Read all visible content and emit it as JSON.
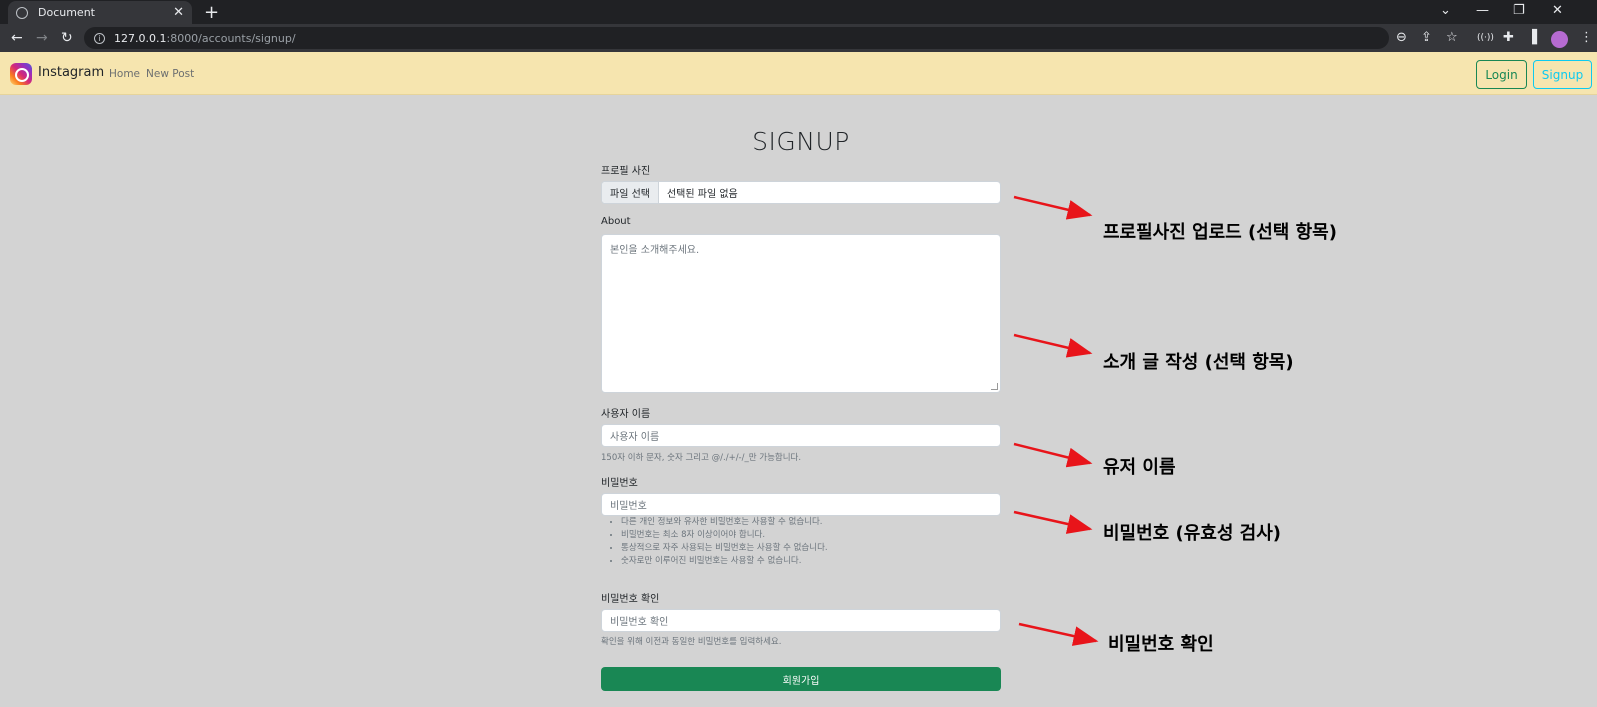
{
  "browser": {
    "tab_title": "Document",
    "url_host": "127.0.0.1",
    "url_path": ":8000/accounts/signup/"
  },
  "navbar": {
    "brand": "Instagram",
    "links": [
      "Home",
      "New Post"
    ],
    "login": "Login",
    "signup": "Signup"
  },
  "form": {
    "title": "SIGNUP",
    "profile_label": "프로필 사진",
    "file_button": "파일 선택",
    "file_status": "선택된 파일 없음",
    "about_label": "About",
    "about_placeholder": "본인을 소개해주세요.",
    "username_label": "사용자 이름",
    "username_placeholder": "사용자 이름",
    "username_help": "150자 이하 문자, 숫자 그리고 @/./+/-/_만 가능합니다.",
    "password_label": "비밀번호",
    "password_placeholder": "비밀번호",
    "password_help": [
      "다른 개인 정보와 유사한 비밀번호는 사용할 수 없습니다.",
      "비밀번호는 최소 8자 이상이어야 합니다.",
      "통상적으로 자주 사용되는 비밀번호는 사용할 수 없습니다.",
      "숫자로만 이루어진 비밀번호는 사용할 수 없습니다."
    ],
    "password_confirm_label": "비밀번호 확인",
    "password_confirm_placeholder": "비밀번호 확인",
    "password_confirm_help": "확인을 위해 이전과 동일한 비밀번호를 입력하세요.",
    "submit": "회원가입"
  },
  "annotations": {
    "profile": "프로필사진 업로드 (선택 항목)",
    "about": "소개 글 작성 (선택 항목)",
    "username": "유저 이름",
    "password": "비밀번호 (유효성 검사)",
    "confirm": "비밀번호 확인",
    "arrow_color": "#e8141a"
  }
}
